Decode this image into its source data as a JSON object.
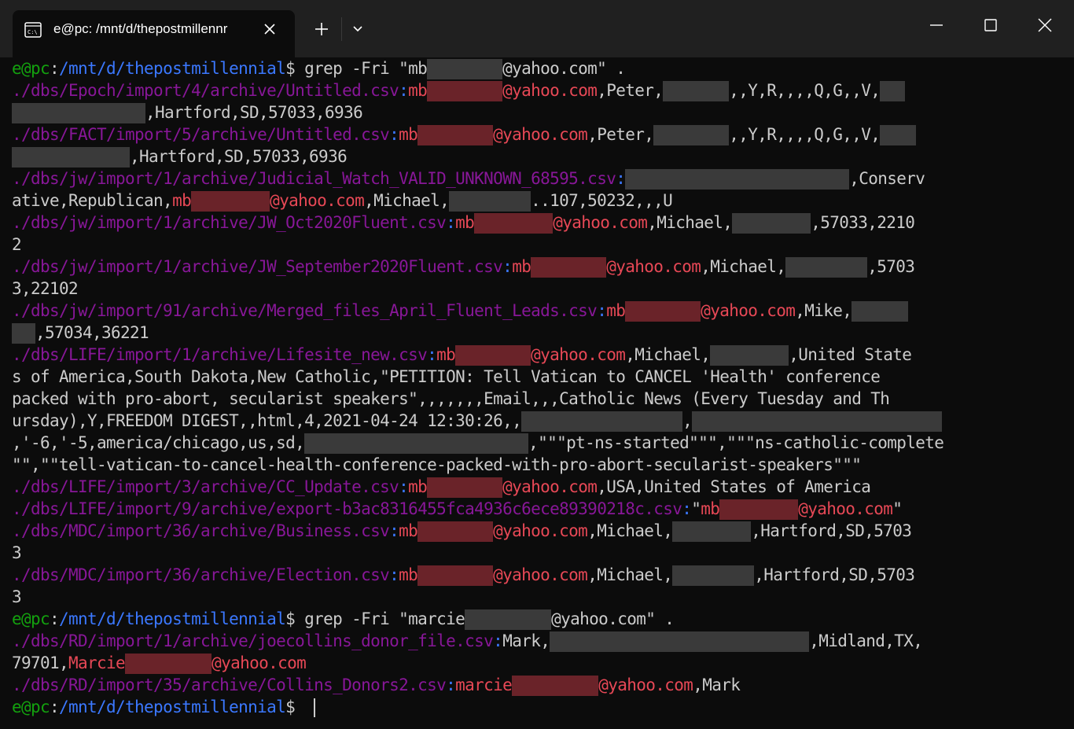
{
  "window": {
    "tab_title": "e@pc: /mnt/d/thepostmillennr",
    "icons": [
      "terminal-icon",
      "close-icon",
      "plus-icon",
      "chevron-down-icon",
      "minimize-icon",
      "maximize-icon",
      "close-window-icon"
    ]
  },
  "colors": {
    "user_host": "#13a10e",
    "path": "#3b78ff",
    "filename": "#881798",
    "match": "#e74856",
    "text": "#cccccc",
    "background": "#0c0c0c"
  },
  "terminal": {
    "prompt_user": "e@pc",
    "prompt_path": "/mnt/d/thepostmillennial",
    "prompt_symbol": "$",
    "lines": [
      [
        {
          "t": "e@pc",
          "c": "g"
        },
        {
          "t": ":",
          "c": "w"
        },
        {
          "t": "/mnt/d/thepostmillennial",
          "c": "b"
        },
        {
          "t": "$ grep -Fri \"mb",
          "c": "w"
        },
        {
          "blur": 96
        },
        {
          "t": "@yahoo.com\" .",
          "c": "w"
        }
      ],
      [
        {
          "t": "./dbs/Epoch/import/4/archive/Untitled.csv",
          "c": "m"
        },
        {
          "t": ":",
          "c": "b"
        },
        {
          "t": "mb",
          "c": "r"
        },
        {
          "blur": 96,
          "red": true
        },
        {
          "t": "@yahoo.com",
          "c": "r"
        },
        {
          "t": ",Peter,",
          "c": "w"
        },
        {
          "blur": 84
        },
        {
          "t": ",,Y,R,,,,Q,G,,V,",
          "c": "w"
        },
        {
          "blur": 32
        }
      ],
      [
        {
          "blur": 170
        },
        {
          "t": ",Hartford,SD,57033,6936",
          "c": "w"
        }
      ],
      [
        {
          "t": "./dbs/FACT/import/5/archive/Untitled.csv",
          "c": "m"
        },
        {
          "t": ":",
          "c": "b"
        },
        {
          "t": "mb",
          "c": "r"
        },
        {
          "blur": 96,
          "red": true
        },
        {
          "t": "@yahoo.com",
          "c": "r"
        },
        {
          "t": ",Peter,",
          "c": "w"
        },
        {
          "blur": 96
        },
        {
          "t": ",,Y,R,,,,Q,G,,V,",
          "c": "w"
        },
        {
          "blur": 46
        }
      ],
      [
        {
          "blur": 150
        },
        {
          "t": ",Hartford,SD,57033,6936",
          "c": "w"
        }
      ],
      [
        {
          "t": "./dbs/jw/import/1/archive/Judicial_Watch_VALID_UNKNOWN_68595.csv",
          "c": "m"
        },
        {
          "t": ":",
          "c": "b"
        },
        {
          "blur": 285
        },
        {
          "t": ",Conserv",
          "c": "w"
        }
      ],
      [
        {
          "t": "ative,Republican,",
          "c": "w"
        },
        {
          "t": "mb",
          "c": "r"
        },
        {
          "blur": 100,
          "red": true
        },
        {
          "t": "@yahoo.com",
          "c": "r"
        },
        {
          "t": ",Michael,",
          "c": "w"
        },
        {
          "blur": 104
        },
        {
          "t": "..107,50232,,,U",
          "c": "w"
        }
      ],
      [
        {
          "t": "./dbs/jw/import/1/archive/JW_Oct2020Fluent.csv",
          "c": "m"
        },
        {
          "t": ":",
          "c": "b"
        },
        {
          "t": "mb",
          "c": "r"
        },
        {
          "blur": 100,
          "red": true
        },
        {
          "t": "@yahoo.com",
          "c": "r"
        },
        {
          "t": ",Michael,",
          "c": "w"
        },
        {
          "blur": 100
        },
        {
          "t": ",57033,2210",
          "c": "w"
        }
      ],
      [
        {
          "t": "2",
          "c": "w"
        }
      ],
      [
        {
          "t": "./dbs/jw/import/1/archive/JW_September2020Fluent.csv",
          "c": "m"
        },
        {
          "t": ":",
          "c": "b"
        },
        {
          "t": "mb",
          "c": "r"
        },
        {
          "blur": 96,
          "red": true
        },
        {
          "t": "@yahoo.com",
          "c": "r"
        },
        {
          "t": ",Michael,",
          "c": "w"
        },
        {
          "blur": 104
        },
        {
          "t": ",5703",
          "c": "w"
        }
      ],
      [
        {
          "t": "3,22102",
          "c": "w"
        }
      ],
      [
        {
          "t": "./dbs/jw/import/91/archive/Merged_files_April_Fluent_Leads.csv",
          "c": "m"
        },
        {
          "t": ":",
          "c": "b"
        },
        {
          "t": "mb",
          "c": "r"
        },
        {
          "blur": 96,
          "red": true
        },
        {
          "t": "@yahoo.com",
          "c": "r"
        },
        {
          "t": ",Mike,",
          "c": "w"
        },
        {
          "blur": 72
        }
      ],
      [
        {
          "blur": 30
        },
        {
          "t": ",57034,36221",
          "c": "w"
        }
      ],
      [
        {
          "t": "./dbs/LIFE/import/1/archive/Lifesite_new.csv",
          "c": "m"
        },
        {
          "t": ":",
          "c": "b"
        },
        {
          "t": "mb",
          "c": "r"
        },
        {
          "blur": 96,
          "red": true
        },
        {
          "t": "@yahoo.com",
          "c": "r"
        },
        {
          "t": ",Michael,",
          "c": "w"
        },
        {
          "blur": 100
        },
        {
          "t": ",United State",
          "c": "w"
        }
      ],
      [
        {
          "t": "s of America,South Dakota,New Catholic,\"PETITION: Tell Vatican to CANCEL 'Health' conference",
          "c": "w"
        }
      ],
      [
        {
          "t": "packed with pro-abort, secularist speakers\",,,,,,,Email,,,Catholic News (Every Tuesday and Th",
          "c": "w"
        }
      ],
      [
        {
          "t": "ursday),Y,FREEDOM DIGEST,,html,4,2021-04-24 12:30:26,,",
          "c": "w"
        },
        {
          "blur": 205
        },
        {
          "t": ",",
          "c": "w"
        },
        {
          "blur": 318
        }
      ],
      [
        {
          "t": ",'-6,'-5,america/chicago,us,sd,",
          "c": "w"
        },
        {
          "blur": 285
        },
        {
          "t": ",\"\"\"pt-ns-started\"\"\",\"\"\"ns-catholic-complete",
          "c": "w"
        }
      ],
      [
        {
          "t": "\"\",\"\"tell-vatican-to-cancel-health-conference-packed-with-pro-abort-secularist-speakers\"\"\"",
          "c": "w"
        }
      ],
      [
        {
          "t": "./dbs/LIFE/import/3/archive/CC_Update.csv",
          "c": "m"
        },
        {
          "t": ":",
          "c": "b"
        },
        {
          "t": "mb",
          "c": "r"
        },
        {
          "blur": 96,
          "red": true
        },
        {
          "t": "@yahoo.com",
          "c": "r"
        },
        {
          "t": ",USA,United States of America",
          "c": "w"
        }
      ],
      [
        {
          "t": "./dbs/LIFE/import/9/archive/export-b3ac8316455fca4936c6ece89390218c.csv",
          "c": "m"
        },
        {
          "t": ":",
          "c": "b"
        },
        {
          "t": "\"",
          "c": "w"
        },
        {
          "t": "mb",
          "c": "r"
        },
        {
          "blur": 100,
          "red": true
        },
        {
          "t": "@yahoo.com",
          "c": "r"
        },
        {
          "t": "\"",
          "c": "w"
        }
      ],
      [
        {
          "t": "./dbs/MDC/import/36/archive/Business.csv",
          "c": "m"
        },
        {
          "t": ":",
          "c": "b"
        },
        {
          "t": "mb",
          "c": "r"
        },
        {
          "blur": 96,
          "red": true
        },
        {
          "t": "@yahoo.com",
          "c": "r"
        },
        {
          "t": ",Michael,",
          "c": "w"
        },
        {
          "blur": 100
        },
        {
          "t": ",Hartford,SD,5703",
          "c": "w"
        }
      ],
      [
        {
          "t": "3",
          "c": "w"
        }
      ],
      [
        {
          "t": "./dbs/MDC/import/36/archive/Election.csv",
          "c": "m"
        },
        {
          "t": ":",
          "c": "b"
        },
        {
          "t": "mb",
          "c": "r"
        },
        {
          "blur": 96,
          "red": true
        },
        {
          "t": "@yahoo.com",
          "c": "r"
        },
        {
          "t": ",Michael,",
          "c": "w"
        },
        {
          "blur": 104
        },
        {
          "t": ",Hartford,SD,5703",
          "c": "w"
        }
      ],
      [
        {
          "t": "3",
          "c": "w"
        }
      ],
      [
        {
          "t": "e@pc",
          "c": "g"
        },
        {
          "t": ":",
          "c": "w"
        },
        {
          "t": "/mnt/d/thepostmillennial",
          "c": "b"
        },
        {
          "t": "$ grep -Fri \"marcie",
          "c": "w"
        },
        {
          "blur": 110
        },
        {
          "t": "@yahoo.com\" .",
          "c": "w"
        }
      ],
      [
        {
          "t": "./dbs/RD/import/1/archive/joecollins_donor_file.csv",
          "c": "m"
        },
        {
          "t": ":",
          "c": "b"
        },
        {
          "t": "Mark,",
          "c": "w"
        },
        {
          "blur": 330
        },
        {
          "t": ",Midland,TX,",
          "c": "w"
        }
      ],
      [
        {
          "t": "79701,",
          "c": "w"
        },
        {
          "t": "Marcie",
          "c": "r"
        },
        {
          "blur": 110,
          "red": true
        },
        {
          "t": "@yahoo.com",
          "c": "r"
        }
      ],
      [
        {
          "t": "./dbs/RD/import/35/archive/Collins_Donors2.csv",
          "c": "m"
        },
        {
          "t": ":",
          "c": "b"
        },
        {
          "t": "marcie",
          "c": "r"
        },
        {
          "blur": 110,
          "red": true
        },
        {
          "t": "@yahoo.com",
          "c": "r"
        },
        {
          "t": ",Mark",
          "c": "w"
        }
      ],
      [
        {
          "t": "e@pc",
          "c": "g"
        },
        {
          "t": ":",
          "c": "w"
        },
        {
          "t": "/mnt/d/thepostmillennial",
          "c": "b"
        },
        {
          "t": "$ ",
          "c": "w"
        },
        {
          "cursor": true
        }
      ]
    ]
  }
}
